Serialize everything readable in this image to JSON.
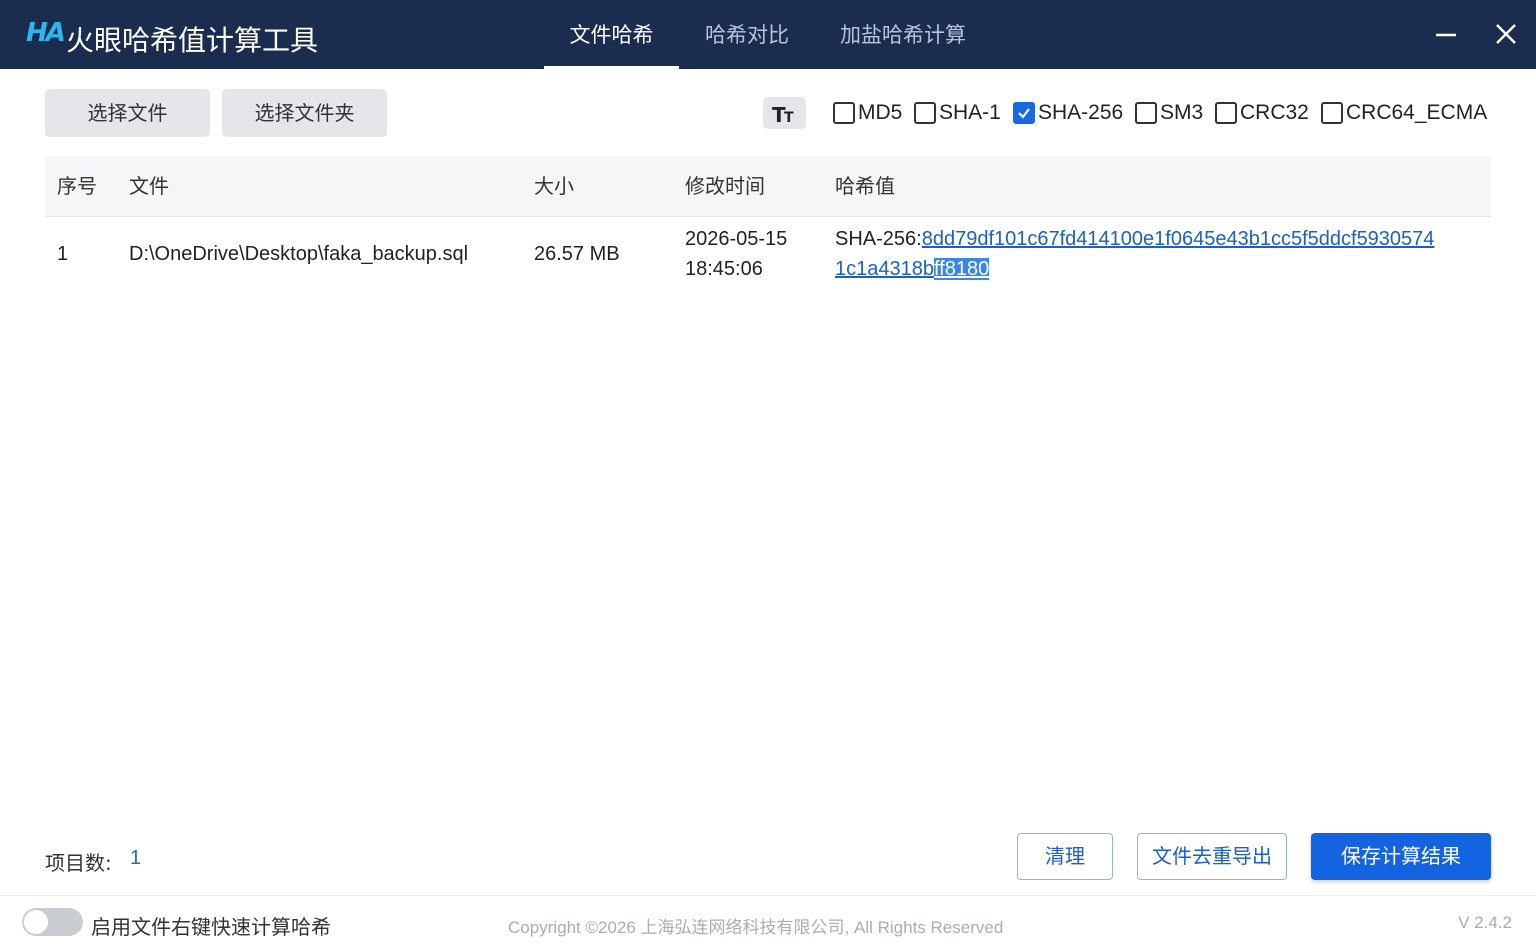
{
  "app": {
    "logo": "HA",
    "title": "火眼哈希值计算工具"
  },
  "tabs": [
    {
      "label": "文件哈希",
      "active": true
    },
    {
      "label": "哈希对比",
      "active": false
    },
    {
      "label": "加盐哈希计算",
      "active": false
    }
  ],
  "window_controls": [
    "minimize-icon",
    "close-icon"
  ],
  "toolbar": {
    "select_file": "选择文件",
    "select_folder": "选择文件夹",
    "font_size_icon": "font-size-icon",
    "algorithms": [
      {
        "label": "MD5",
        "checked": false
      },
      {
        "label": "SHA-1",
        "checked": false
      },
      {
        "label": "SHA-256",
        "checked": true
      },
      {
        "label": "SM3",
        "checked": false
      },
      {
        "label": "CRC32",
        "checked": false
      },
      {
        "label": "CRC64_ECMA",
        "checked": false
      }
    ]
  },
  "table": {
    "headers": [
      "序号",
      "文件",
      "大小",
      "修改时间",
      "哈希值"
    ],
    "rows": [
      {
        "index": "1",
        "file": "D:\\OneDrive\\Desktop\\faka_backup.sql",
        "size": "26.57 MB",
        "modified_date": "2026-05-15",
        "modified_time": "18:45:06",
        "hash_prefix": "SHA-256:",
        "hash_line1": "8dd79df101c67fd414100e1f0645e43b1cc5f5ddcf5930574",
        "hash_line2": "1c1a4318b",
        "hash_selected": "ff8180"
      }
    ]
  },
  "footer": {
    "count_label": "项目数:",
    "count_value": "1",
    "clear": "清理",
    "dedupe_export": "文件去重导出",
    "save": "保存计算结果"
  },
  "statusbar": {
    "toggle_label": "启用文件右键快速计算哈希",
    "toggle_on": false,
    "copyright": "Copyright ©2026 上海弘连网络科技有限公司, All Rights Reserved",
    "version": "V 2.4.2"
  },
  "colors": {
    "titlebar": "#1b2d4f",
    "accent": "#1463e0",
    "link": "#1a5fd0"
  }
}
